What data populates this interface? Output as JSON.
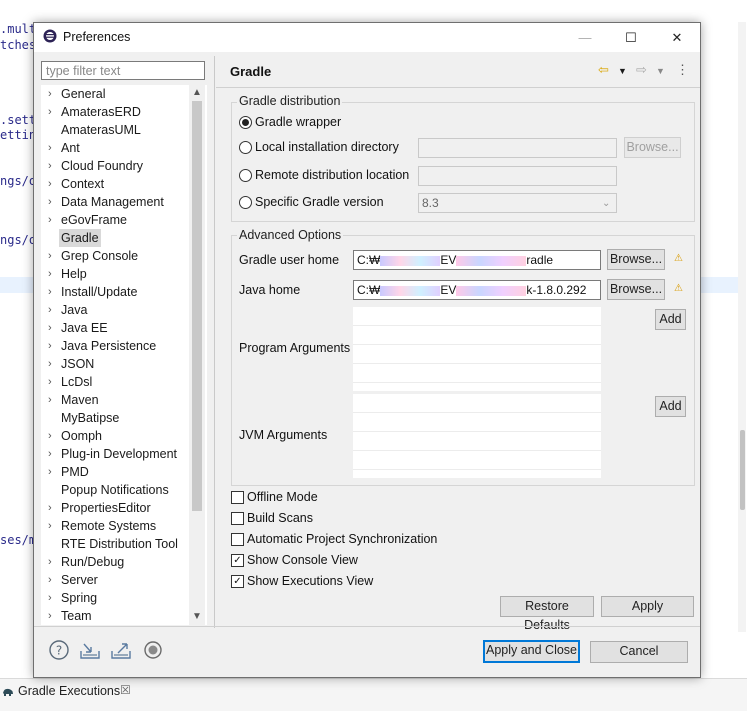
{
  "background": {
    "code_lines": [
      ".mult",
      "tches",
      ".sett",
      "ettin",
      "ngs/o",
      "ngs/o",
      "ses/m"
    ],
    "bottom_tab": {
      "label": "Gradle Executions",
      "close": "☒"
    }
  },
  "dialog": {
    "title": "Preferences",
    "window_buttons": {
      "minimize": "—",
      "maximize": "☐",
      "close": "✕"
    },
    "filter_placeholder": "type filter text",
    "tree": [
      {
        "label": "General",
        "expandable": true
      },
      {
        "label": "AmaterasERD",
        "expandable": true
      },
      {
        "label": "AmaterasUML",
        "expandable": false
      },
      {
        "label": "Ant",
        "expandable": true
      },
      {
        "label": "Cloud Foundry",
        "expandable": true
      },
      {
        "label": "Context",
        "expandable": true
      },
      {
        "label": "Data Management",
        "expandable": true
      },
      {
        "label": "eGovFrame",
        "expandable": true
      },
      {
        "label": "Gradle",
        "expandable": false,
        "selected": true
      },
      {
        "label": "Grep Console",
        "expandable": true
      },
      {
        "label": "Help",
        "expandable": true
      },
      {
        "label": "Install/Update",
        "expandable": true
      },
      {
        "label": "Java",
        "expandable": true
      },
      {
        "label": "Java EE",
        "expandable": true
      },
      {
        "label": "Java Persistence",
        "expandable": true
      },
      {
        "label": "JSON",
        "expandable": true
      },
      {
        "label": "LcDsl",
        "expandable": true
      },
      {
        "label": "Maven",
        "expandable": true
      },
      {
        "label": "MyBatipse",
        "expandable": false
      },
      {
        "label": "Oomph",
        "expandable": true
      },
      {
        "label": "Plug-in Development",
        "expandable": true
      },
      {
        "label": "PMD",
        "expandable": true
      },
      {
        "label": "Popup Notifications",
        "expandable": false
      },
      {
        "label": "PropertiesEditor",
        "expandable": true
      },
      {
        "label": "Remote Systems",
        "expandable": true
      },
      {
        "label": "RTE Distribution Tool",
        "expandable": false
      },
      {
        "label": "Run/Debug",
        "expandable": true
      },
      {
        "label": "Server",
        "expandable": true
      },
      {
        "label": "Spring",
        "expandable": true
      },
      {
        "label": "Team",
        "expandable": true
      }
    ],
    "page": {
      "title": "Gradle",
      "distribution": {
        "group_label": "Gradle distribution",
        "options": [
          {
            "label": "Gradle wrapper",
            "selected": true
          },
          {
            "label": "Local installation directory",
            "selected": false
          },
          {
            "label": "Remote distribution location",
            "selected": false
          },
          {
            "label": "Specific Gradle version",
            "selected": false
          }
        ],
        "browse_label": "Browse...",
        "version_value": "8.3"
      },
      "advanced": {
        "group_label": "Advanced Options",
        "user_home_label": "Gradle user home",
        "user_home_value_start": "C:₩",
        "user_home_value_mid": "EV",
        "user_home_value_end": "radle",
        "java_home_label": "Java home",
        "java_home_value_start": "C:₩",
        "java_home_value_mid": "EV",
        "java_home_value_end": "k-1.8.0.292",
        "browse_label": "Browse...",
        "program_args_label": "Program Arguments",
        "jvm_args_label": "JVM Arguments",
        "add_label": "Add"
      },
      "checkboxes": [
        {
          "label": "Offline Mode",
          "checked": false
        },
        {
          "label": "Build Scans",
          "checked": false
        },
        {
          "label": "Automatic Project Synchronization",
          "checked": false
        },
        {
          "label": "Show Console View",
          "checked": true
        },
        {
          "label": "Show Executions View",
          "checked": true
        }
      ],
      "restore_defaults_label": "Restore Defaults",
      "apply_label": "Apply"
    },
    "footer": {
      "apply_close_label": "Apply and Close",
      "cancel_label": "Cancel"
    }
  }
}
